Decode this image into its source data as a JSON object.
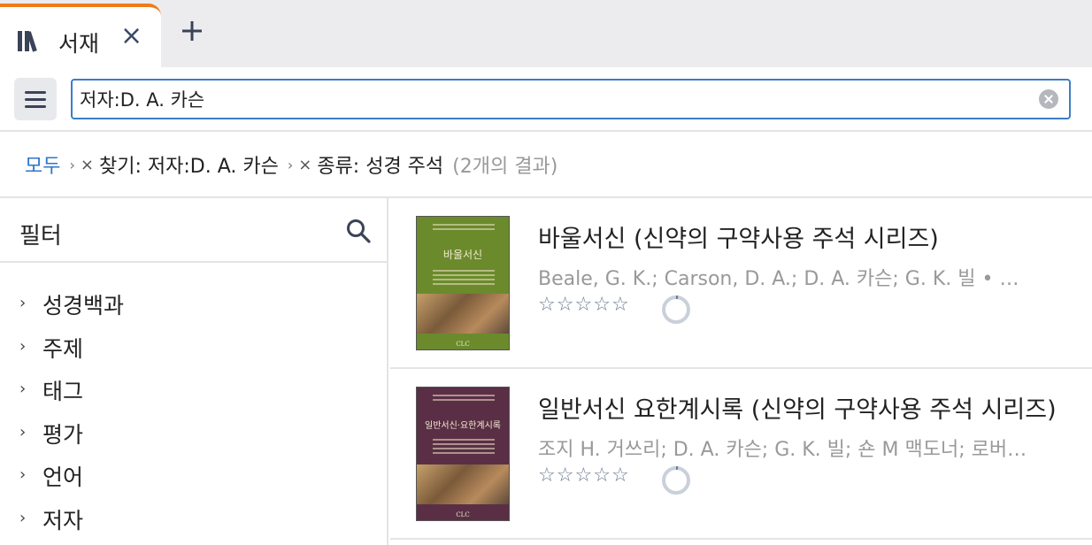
{
  "tab": {
    "title": "서재",
    "icon": "library-books-icon",
    "accent_color": "#f07a1a"
  },
  "search": {
    "value": "저자:D. A. 카슨"
  },
  "breadcrumb": {
    "root": "모두",
    "filters": [
      {
        "label": "찾기: 저자:D. A. 카슨"
      },
      {
        "label": "종류: 성경 주석"
      }
    ],
    "result_count": "(2개의 결과)"
  },
  "filter_panel": {
    "title": "필터",
    "items": [
      {
        "label": "성경백과"
      },
      {
        "label": "주제"
      },
      {
        "label": "태그"
      },
      {
        "label": "평가"
      },
      {
        "label": "언어"
      },
      {
        "label": "저자"
      }
    ]
  },
  "results": [
    {
      "title": "바울서신 (신약의 구약사용 주석 시리즈)",
      "authors": "Beale, G. K.; Carson, D. A.; D. A. 카슨; G. K. 빌 • 조지 H. 거쓰리",
      "rating": 0,
      "progress": 0.02,
      "cover": {
        "title": "바울서신",
        "publisher": "CLC",
        "color": "#6b8a2c"
      }
    },
    {
      "title": "일반서신 요한계시록 (신약의 구약사용 주석 시리즈)",
      "authors": "조지 H. 거쓰리; D. A. 카슨; G. K. 빌; 숀 M 맥도너; 로버트 L. 플러머",
      "rating": 0,
      "progress": 0.02,
      "cover": {
        "title": "일반서신·요한계시록",
        "publisher": "CLC",
        "color": "#5a2f45"
      }
    }
  ]
}
